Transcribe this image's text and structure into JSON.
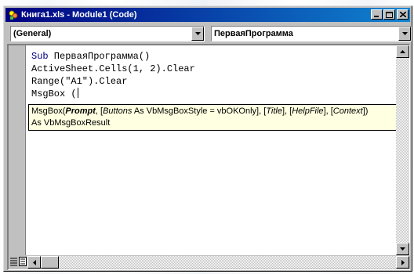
{
  "window": {
    "title": "Книга1.xls - Module1 (Code)",
    "title_color": "#000080"
  },
  "combos": {
    "object": "(General)",
    "procedure": "ПерваяПрограмма"
  },
  "code": {
    "line1_kw": "Sub",
    "line1_rest": " ПерваяПрограмма()",
    "line2": "ActiveSheet.Cells(1, 2).Clear",
    "line3": "Range(\"A1\").Clear",
    "line4": "MsgBox ("
  },
  "tooltip": {
    "part1": "MsgBox(",
    "prompt": "Prompt",
    "part2": ", [",
    "buttons": "Buttons",
    "part3": " As VbMsgBoxStyle = vbOKOnly], [",
    "title": "Title",
    "part4": "], [",
    "helpfile": "HelpFile",
    "part5": "], [",
    "context": "Context",
    "part6": "])",
    "line2": "As VbMsgBoxResult",
    "bg_color": "#ffffe1"
  },
  "icons": [
    "app-icon",
    "minimize-icon",
    "maximize-icon",
    "close-icon",
    "dropdown-arrow-icon",
    "scroll-up-icon",
    "scroll-down-icon",
    "scroll-left-icon",
    "scroll-right-icon",
    "procedure-view-icon",
    "full-module-view-icon"
  ]
}
